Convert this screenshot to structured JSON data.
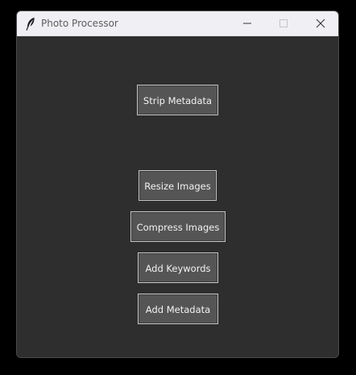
{
  "window": {
    "title": "Photo Processor",
    "icon": "feather-icon",
    "controls": [
      "minimize-icon",
      "maximize-icon",
      "close-icon"
    ]
  },
  "buttons": {
    "strip_metadata": "Strip Metadata",
    "resize_images": "Resize Images",
    "compress_images": "Compress Images",
    "add_keywords": "Add Keywords",
    "add_metadata": "Add Metadata"
  },
  "colors": {
    "background": "#2e2e2e",
    "button_fill": "#555555",
    "button_border": "#c6c6c6",
    "button_text": "#f2f2f2",
    "titlebar": "#f0f0f4"
  }
}
